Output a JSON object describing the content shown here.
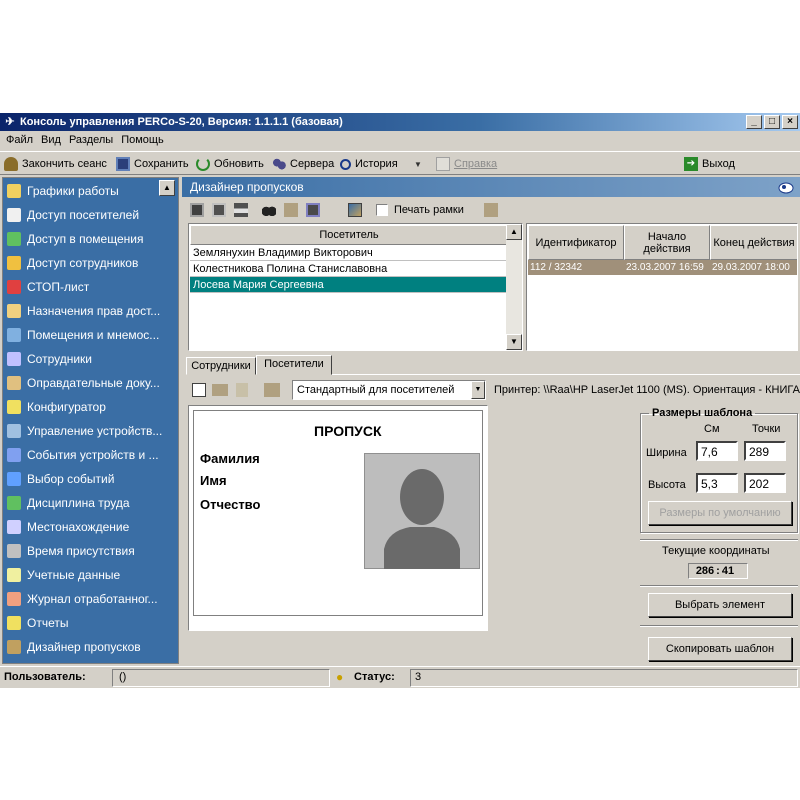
{
  "window": {
    "title": "Консоль управления PERCo-S-20, Версия: 1.1.1.1 (базовая)",
    "controls": [
      "_",
      "□",
      "×"
    ]
  },
  "menu": [
    "Файл",
    "Вид",
    "Разделы",
    "Помощь"
  ],
  "toolbar": {
    "end_session": "Закончить сеанс",
    "save": "Сохранить",
    "refresh": "Обновить",
    "servers": "Сервера",
    "history": "История",
    "help": "Справка",
    "exit": "Выход"
  },
  "sidebar": {
    "items": [
      {
        "label": "Графики работы",
        "icon": "calendar-icon"
      },
      {
        "label": "Доступ посетителей",
        "icon": "visitor-card-icon"
      },
      {
        "label": "Доступ в помещения",
        "icon": "door-icon"
      },
      {
        "label": "Доступ сотрудников",
        "icon": "lock-icon"
      },
      {
        "label": "СТОП-лист",
        "icon": "stop-icon"
      },
      {
        "label": "Назначения прав дост...",
        "icon": "rights-icon"
      },
      {
        "label": "Помещения и мнемос...",
        "icon": "rooms-icon"
      },
      {
        "label": "Сотрудники",
        "icon": "employees-icon"
      },
      {
        "label": "Оправдательные доку...",
        "icon": "documents-icon"
      },
      {
        "label": "Конфигуратор",
        "icon": "configurator-icon"
      },
      {
        "label": "Управление устройств...",
        "icon": "device-control-icon"
      },
      {
        "label": "События устройств и ...",
        "icon": "device-events-icon"
      },
      {
        "label": "Выбор событий",
        "icon": "event-select-icon"
      },
      {
        "label": "Дисциплина труда",
        "icon": "discipline-icon"
      },
      {
        "label": "Местонахождение",
        "icon": "location-icon"
      },
      {
        "label": "Время присутствия",
        "icon": "presence-time-icon"
      },
      {
        "label": "Учетные данные",
        "icon": "accounting-icon"
      },
      {
        "label": "Журнал отработанног...",
        "icon": "journal-icon"
      },
      {
        "label": "Отчеты",
        "icon": "reports-icon"
      },
      {
        "label": "Дизайнер пропусков",
        "icon": "pass-designer-icon"
      }
    ]
  },
  "panel": {
    "title": "Дизайнер пропусков",
    "print_frames_label": "Печать рамки"
  },
  "visitors": {
    "header": "Посетитель",
    "rows": [
      {
        "name": "Землянухин Владимир Викторович",
        "selected": false
      },
      {
        "name": "Колестникова Полина Станиславовна",
        "selected": false
      },
      {
        "name": "Лосева Мария Сергеевна",
        "selected": true
      }
    ]
  },
  "passes": {
    "headers": {
      "id": "Идентификатор",
      "start": "Начало действия",
      "end": "Конец действия"
    },
    "rows": [
      {
        "id": "112 / 32342",
        "start": "23.03.2007 16:59",
        "end": "29.03.2007 18:00"
      }
    ]
  },
  "tabs": [
    {
      "label": "Сотрудники",
      "active": false
    },
    {
      "label": "Посетители",
      "active": true
    }
  ],
  "designer": {
    "template_select": "Стандартный для посетителей",
    "printer_info": "Принтер: \\\\Raa\\HP LaserJet 1100 (MS). Ориентация - КНИГА"
  },
  "card": {
    "title": "ПРОПУСК",
    "fields": [
      "Фамилия",
      "Имя",
      "Отчество"
    ]
  },
  "template_size": {
    "legend": "Размеры шаблона",
    "col_cm": "См",
    "col_points": "Точки",
    "width_label": "Ширина",
    "height_label": "Высота",
    "width_cm": "7,6",
    "width_points": "289",
    "height_cm": "5,3",
    "height_points": "202",
    "default_button": "Размеры по умолчанию"
  },
  "coords": {
    "label": "Текущие координаты",
    "x": "286",
    "y": "41"
  },
  "buttons": {
    "select_element": "Выбрать элемент",
    "copy_template": "Скопировать шаблон"
  },
  "statusbar": {
    "user_label": "Пользователь:",
    "user_value": "()",
    "status_label": "Статус:",
    "status_value": "3"
  }
}
